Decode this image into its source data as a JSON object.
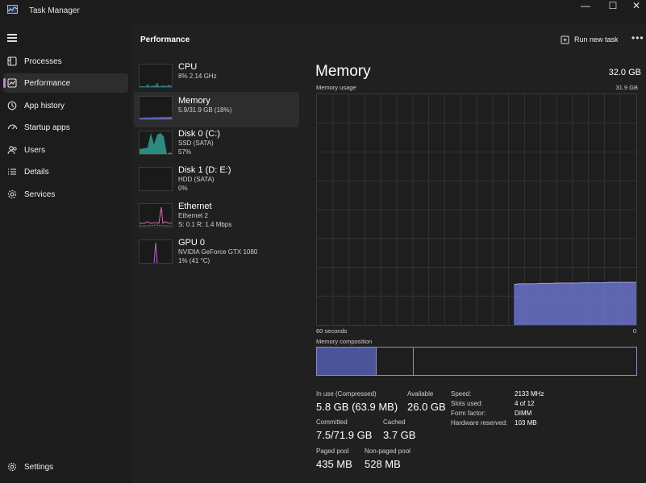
{
  "window": {
    "title": "Task Manager",
    "minimize_glyph": "—",
    "maximize_glyph": "☐",
    "close_glyph": "✕"
  },
  "nav": {
    "items": [
      {
        "label": "Processes",
        "icon": "processes-icon"
      },
      {
        "label": "Performance",
        "icon": "performance-icon"
      },
      {
        "label": "App history",
        "icon": "history-icon"
      },
      {
        "label": "Startup apps",
        "icon": "startup-icon"
      },
      {
        "label": "Users",
        "icon": "users-icon"
      },
      {
        "label": "Details",
        "icon": "details-icon"
      },
      {
        "label": "Services",
        "icon": "services-icon"
      }
    ],
    "settings_label": "Settings"
  },
  "header": {
    "title": "Performance",
    "run_new_task": "Run new task",
    "more": "•••"
  },
  "devices": [
    {
      "name": "CPU",
      "line1": "8% 2.14 GHz",
      "line2": "",
      "color": "#3a9fb0"
    },
    {
      "name": "Memory",
      "line1": "5.9/31.9 GB (18%)",
      "line2": "",
      "color": "#6b73c9"
    },
    {
      "name": "Disk 0 (C:)",
      "line1": "SSD (SATA)",
      "line2": "57%",
      "color": "#2fa79b"
    },
    {
      "name": "Disk 1 (D: E:)",
      "line1": "HDD (SATA)",
      "line2": "0%",
      "color": "#2fa79b"
    },
    {
      "name": "Ethernet",
      "line1": "Ethernet 2",
      "line2": "S: 0.1 R: 1.4 Mbps",
      "color": "#d070a8"
    },
    {
      "name": "GPU 0",
      "line1": "NVIDIA GeForce GTX 1080",
      "line2": "1% (41 °C)",
      "color": "#b06ad0"
    }
  ],
  "memory": {
    "title": "Memory",
    "total": "32.0 GB",
    "usage_label": "Memory usage",
    "usage_max": "31.9 GB",
    "time_left": "60 seconds",
    "time_right": "0",
    "composition_label": "Memory composition",
    "graph_color": "#6b73c9",
    "usage_history_gb": [
      0,
      0,
      0,
      0,
      0,
      0,
      0,
      0,
      0,
      0,
      0,
      0,
      0,
      0,
      0,
      0,
      0,
      0,
      0,
      0,
      0,
      0,
      0,
      0,
      0,
      0,
      0,
      0,
      0,
      0,
      0,
      0,
      0,
      0,
      0,
      0,
      0,
      5.6,
      5.7,
      5.7,
      5.7,
      5.7,
      5.75,
      5.75,
      5.75,
      5.8,
      5.8,
      5.8,
      5.8,
      5.8,
      5.85,
      5.85,
      5.85,
      5.85,
      5.85,
      5.9,
      5.9,
      5.9,
      5.9,
      5.9,
      5.9
    ],
    "stats": {
      "in_use_label": "In use (Compressed)",
      "in_use_value": "5.8 GB (63.9 MB)",
      "available_label": "Available",
      "available_value": "26.0 GB",
      "committed_label": "Committed",
      "committed_value": "7.5/71.9 GB",
      "cached_label": "Cached",
      "cached_value": "3.7 GB",
      "paged_label": "Paged pool",
      "paged_value": "435 MB",
      "nonpaged_label": "Non-paged pool",
      "nonpaged_value": "528 MB"
    },
    "specs": [
      {
        "label": "Speed:",
        "value": "2133 MHz"
      },
      {
        "label": "Slots used:",
        "value": "4 of 12"
      },
      {
        "label": "Form factor:",
        "value": "DIMM"
      },
      {
        "label": "Hardware reserved:",
        "value": "103 MB"
      }
    ]
  }
}
